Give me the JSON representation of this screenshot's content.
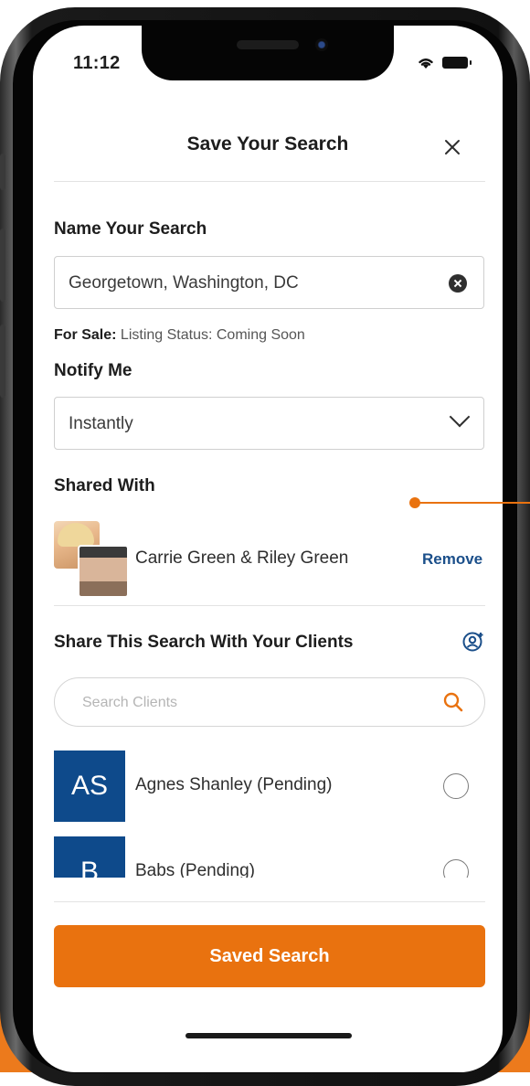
{
  "status_bar": {
    "time": "11:12"
  },
  "header": {
    "title": "Save Your Search"
  },
  "name_section": {
    "label": "Name Your Search",
    "value": "Georgetown, Washington, DC",
    "meta_prefix": "For Sale:",
    "meta_text": " Listing Status: Coming Soon"
  },
  "notify_section": {
    "label": "Notify Me",
    "selected": "Instantly"
  },
  "shared_section": {
    "label": "Shared With",
    "names": "Carrie Green & Riley Green",
    "remove_label": "Remove"
  },
  "share_clients": {
    "label": "Share This Search With Your Clients",
    "search_placeholder": "Search Clients",
    "clients": [
      {
        "initials": "AS",
        "name": "Agnes Shanley (Pending)",
        "selected": false
      },
      {
        "initials": "B",
        "name": "Babs  (Pending)",
        "selected": false
      }
    ]
  },
  "footer": {
    "button_label": "Saved Search"
  },
  "colors": {
    "accent": "#e9720f",
    "client_tile": "#0e4a8b",
    "link": "#1b4f8a"
  },
  "icons": [
    "close-icon",
    "clear-icon",
    "chevron-down-icon",
    "contacts-icon",
    "search-icon",
    "wifi-icon",
    "battery-icon"
  ]
}
